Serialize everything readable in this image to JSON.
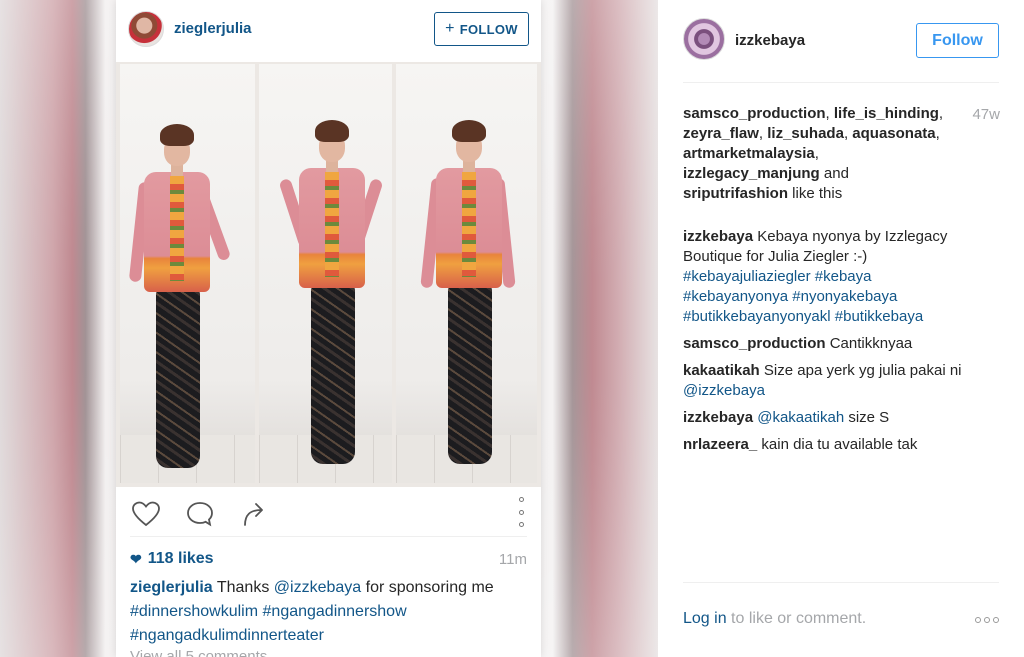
{
  "left_post": {
    "username": "zieglerjulia",
    "follow_label": "FOLLOW",
    "follow_icon": "plus-icon",
    "likes": "118 likes",
    "time": "11m",
    "caption_user": "zieglerjulia",
    "caption_text": "Thanks ",
    "caption_mention": "@izzkebaya",
    "caption_text2": " for sponsoring me",
    "caption_tags": [
      "#dinnershowkulim",
      "#ngangadinnershow",
      "#ngangadkulimdinnerteater"
    ],
    "view_all": "View all 5 comments",
    "actions": [
      "heart-icon",
      "comment-icon",
      "share-icon",
      "more-icon"
    ]
  },
  "right_panel": {
    "username": "izzkebaya",
    "follow_label": "Follow",
    "time": "47w",
    "likers": [
      "samsco_production",
      "life_is_hinding",
      "zeyra_flaw",
      "liz_suhada",
      "aquasonata",
      "artmarketmalaysia",
      "izzlegacy_manjung",
      "sriputrifashion"
    ],
    "likers_and": " and ",
    "likers_suffix": " like this",
    "comments": [
      {
        "user": "izzkebaya",
        "text": "Kebaya nyonya by Izzlegacy Boutique for Julia Ziegler :-)",
        "tags": [
          "#kebayajuliaziegler",
          "#kebaya",
          "#kebayanyonya",
          "#nyonyakebaya",
          "#butikkebayanyonyakl",
          "#butikkebaya"
        ]
      },
      {
        "user": "samsco_production",
        "text": "Cantikknyaa"
      },
      {
        "user": "kakaatikah",
        "text": "Size apa yerk yg julia pakai ni",
        "mention": "@izzkebaya"
      },
      {
        "user": "izzkebaya",
        "mention": "@kakaatikah",
        "text": " size S"
      },
      {
        "user": "nrlazeera_",
        "text": "kain dia tu available tak"
      }
    ],
    "login_link": "Log in",
    "login_text": " to like or comment."
  }
}
